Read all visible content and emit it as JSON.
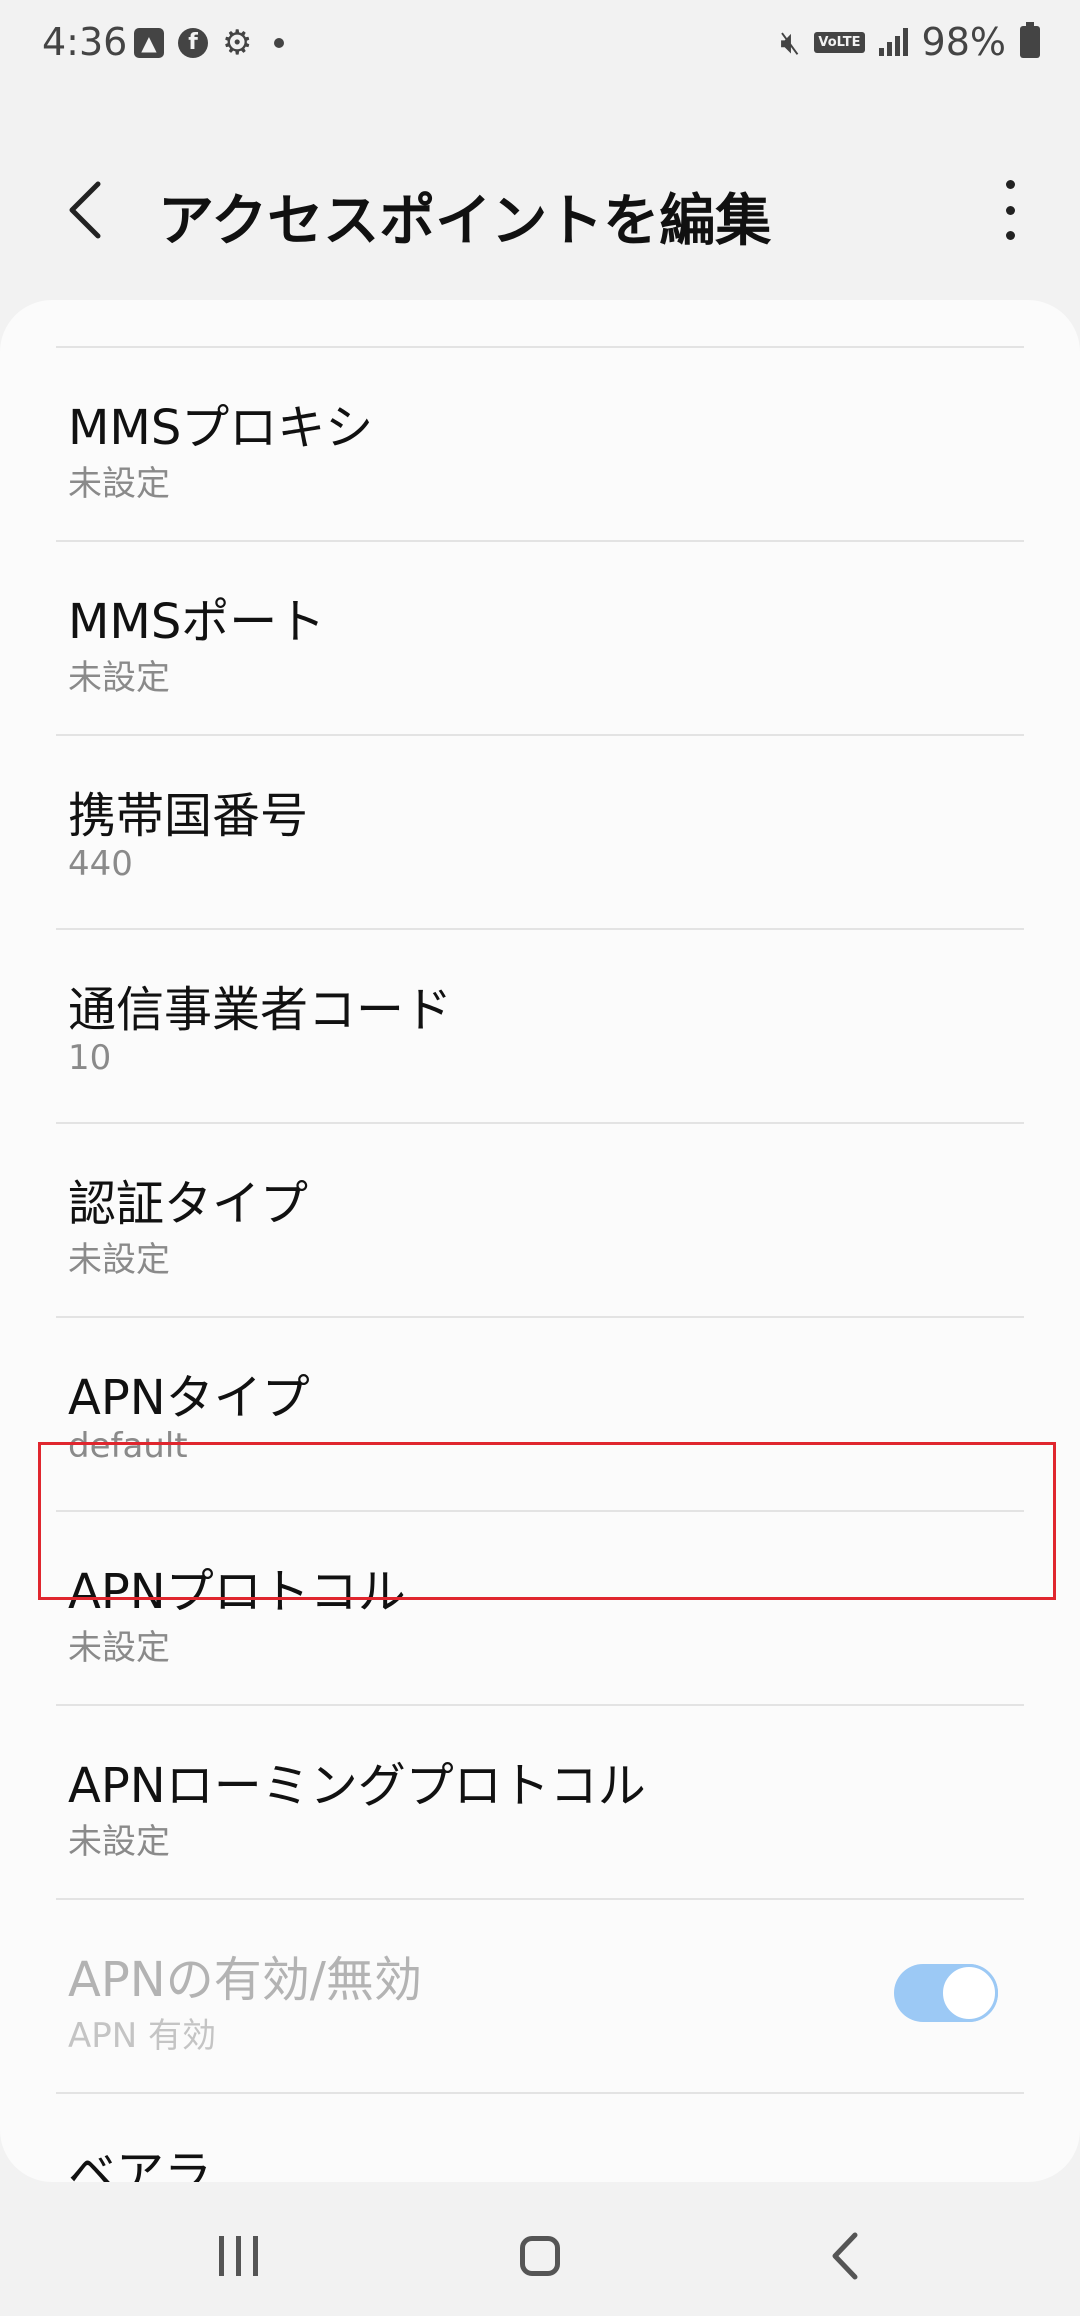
{
  "status_bar": {
    "time": "4:36",
    "left_icons": [
      "gallery-icon",
      "facebook-icon",
      "gear-icon",
      "notification-dot"
    ],
    "facebook_glyph": "f",
    "volte_label": "VoLTE",
    "battery_percent": "98%"
  },
  "header": {
    "title": "アクセスポイントを編集"
  },
  "list": {
    "items": [
      {
        "title": "MMSプロキシ",
        "value": "未設定"
      },
      {
        "title": "MMSポート",
        "value": "未設定"
      },
      {
        "title": "携帯国番号",
        "value": "440"
      },
      {
        "title": "通信事業者コード",
        "value": "10"
      },
      {
        "title": "認証タイプ",
        "value": "未設定",
        "highlighted": true
      },
      {
        "title": "APNタイプ",
        "value": "default"
      },
      {
        "title": "APNプロトコル",
        "value": "未設定"
      },
      {
        "title": "APNローミングプロトコル",
        "value": "未設定"
      },
      {
        "title": "APNの有効/無効",
        "value": "APN 有効",
        "disabled": true,
        "toggle_on": true
      },
      {
        "title": "ベアラ",
        "value": ""
      }
    ]
  },
  "colors": {
    "highlight": "#e0262e",
    "toggle": "#9cc9f5",
    "background": "#f2f2f2",
    "card": "#fbfbfb"
  }
}
